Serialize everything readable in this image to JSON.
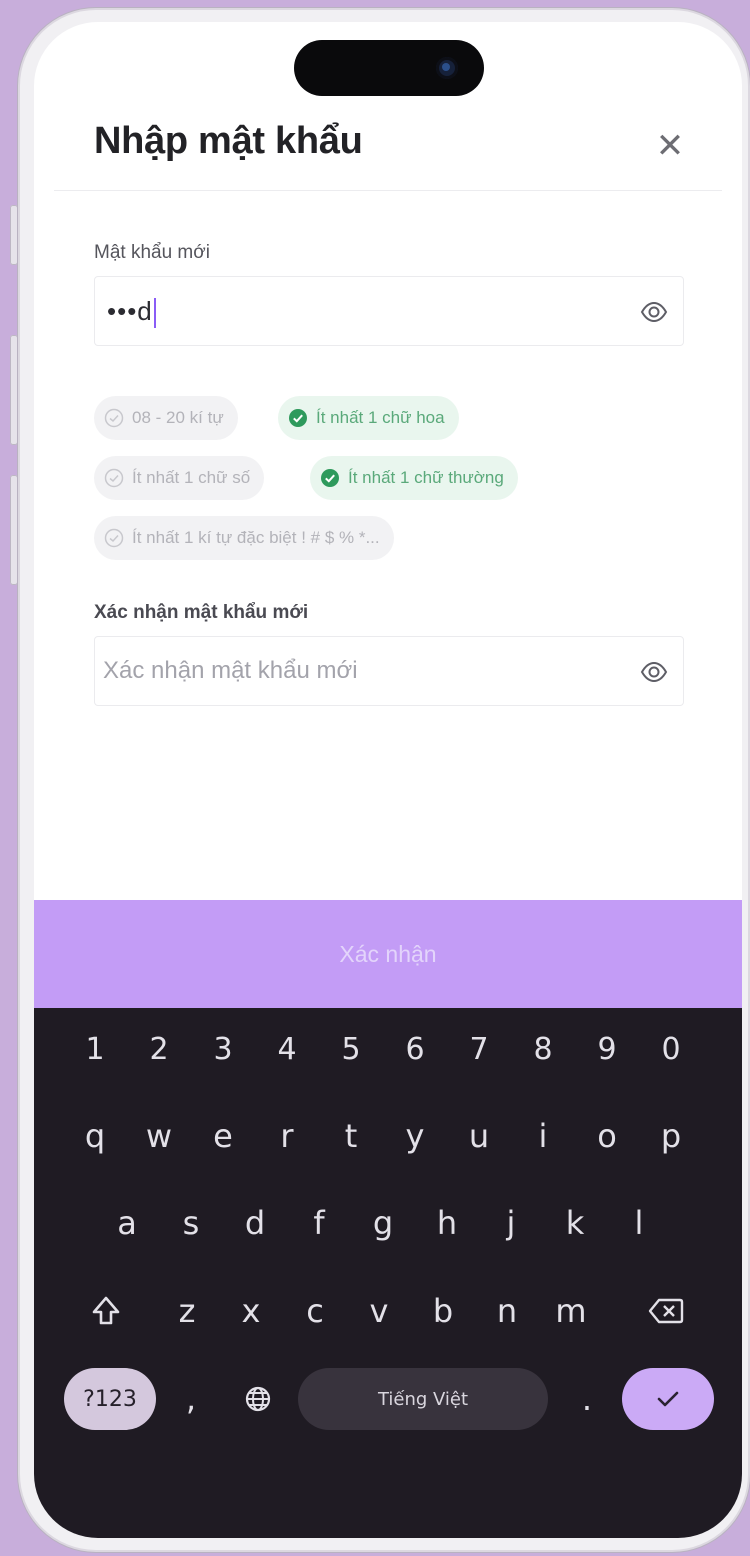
{
  "header": {
    "title": "Nhập mật khẩu",
    "close_icon": "close-icon"
  },
  "new_password": {
    "label": "Mật khẩu mới",
    "value": "•••d",
    "toggle_icon": "eye-icon"
  },
  "requirements": [
    {
      "text": "08 - 20 kí tự",
      "met": false
    },
    {
      "text": "Ít nhất 1 chữ hoa",
      "met": true
    },
    {
      "text": "Ít nhất 1 chữ số",
      "met": false
    },
    {
      "text": "Ít nhất 1 chữ thường",
      "met": true
    },
    {
      "text": "Ít nhất 1 kí tự đặc biệt ! # $ % *...",
      "met": false
    }
  ],
  "confirm_password": {
    "label": "Xác nhận mật khẩu mới",
    "placeholder": "Xác nhận mật khẩu mới",
    "toggle_icon": "eye-icon"
  },
  "confirm_button": {
    "label": "Xác nhận"
  },
  "keyboard": {
    "numbers": [
      "1",
      "2",
      "3",
      "4",
      "5",
      "6",
      "7",
      "8",
      "9",
      "0"
    ],
    "row1": [
      "q",
      "w",
      "e",
      "r",
      "t",
      "y",
      "u",
      "i",
      "o",
      "p"
    ],
    "row2": [
      "a",
      "s",
      "d",
      "f",
      "g",
      "h",
      "j",
      "k",
      "l"
    ],
    "row3": [
      "z",
      "x",
      "c",
      "v",
      "b",
      "n",
      "m"
    ],
    "symbols_label": "?123",
    "comma": ",",
    "space_label": "Tiếng Việt",
    "period": ".",
    "icons": [
      "shift-icon",
      "backspace-icon",
      "globe-icon",
      "checkmark-icon"
    ]
  },
  "colors": {
    "accent": "#c39cf6",
    "success": "#5aa97a",
    "keyboard_bg": "#1f1b23"
  }
}
